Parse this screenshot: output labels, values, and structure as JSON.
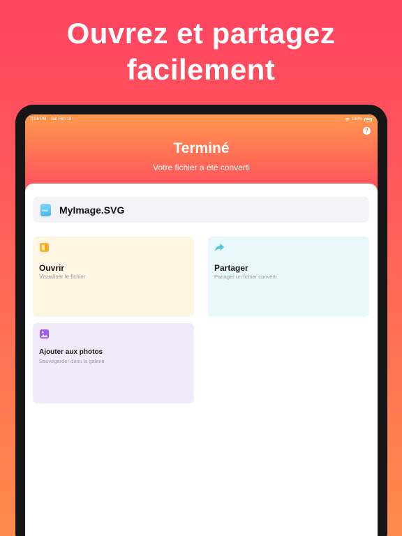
{
  "headline": {
    "line1": "Ouvrez et partagez",
    "line2": "facilement"
  },
  "status_bar": {
    "time": "3:06 PM",
    "date": "Sat Feb 13",
    "battery": "100%"
  },
  "header": {
    "title": "Terminé",
    "subtitle": "Votre fichier a été converti",
    "help_icon": "question-circle-icon"
  },
  "file": {
    "name": "MyImage.SVG",
    "icon": "image-file-icon"
  },
  "actions": [
    {
      "title": "Ouvrir",
      "subtitle": "Visualiser le fichier",
      "icon": "open-file-icon",
      "color": "#fff5e3"
    },
    {
      "title": "Partager",
      "subtitle": "Partager un fichier converti",
      "icon": "share-arrow-icon",
      "color": "#e9f8fa"
    },
    {
      "title": "Ajouter aux photos",
      "subtitle": "Sauvegarder dans la galerie",
      "icon": "photo-icon",
      "color": "#f1ebfb"
    }
  ],
  "colors": {
    "accent_top": "#ff4360",
    "accent_bottom": "#ff8a4c",
    "share_icon": "#4cc7d8",
    "photo_icon": "#9b5de5",
    "open_icon": "#f7b733"
  }
}
